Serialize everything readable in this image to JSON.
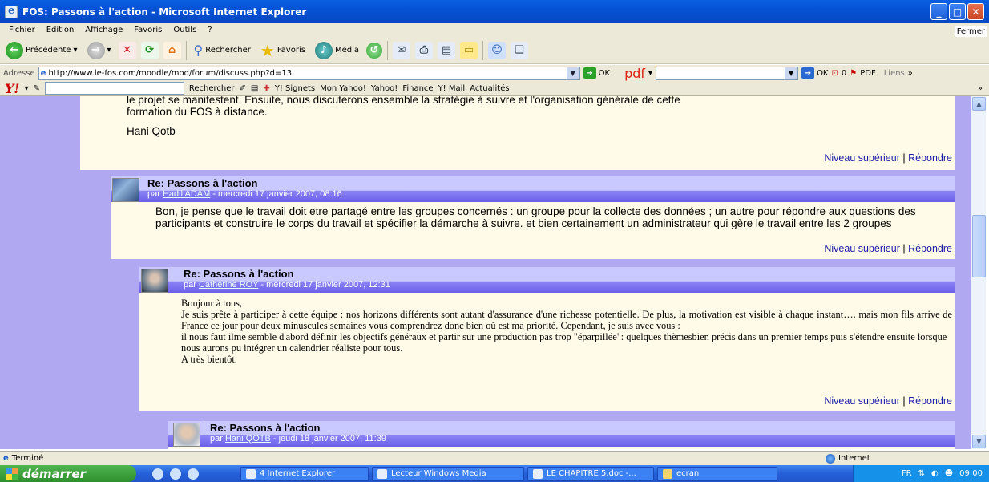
{
  "window": {
    "title": "FOS: Passons à l'action - Microsoft Internet Explorer"
  },
  "menu": {
    "items": [
      "Fichier",
      "Edition",
      "Affichage",
      "Favoris",
      "Outils",
      "?"
    ],
    "fermer": "Fermer"
  },
  "toolbar": {
    "back": "Précédente",
    "search": "Rechercher",
    "favorites": "Favoris",
    "media": "Média"
  },
  "address": {
    "label": "Adresse",
    "url": "http://www.le-fos.com/moodle/mod/forum/discuss.php?d=13",
    "go": "OK",
    "pdf": "pdf",
    "ok2": "OK",
    "count": "0",
    "pdf_btn": "PDF",
    "links": "Liens"
  },
  "yahoo": {
    "search": "Rechercher",
    "items": [
      "Y! Signets",
      "Mon Yahoo!",
      "Yahoo!",
      "Finance",
      "Y! Mail",
      "Actualités"
    ]
  },
  "posts": {
    "p0": {
      "body_lines": [
        "le projet se manifestent. Ensuite, nous discuterons ensemble la stratégie à suivre et l'organisation générale de cette",
        "formation du FOS à distance."
      ],
      "signature": "Hani Qotb",
      "link_up": "Niveau supérieur",
      "link_reply": "Répondre"
    },
    "p1": {
      "title": "Re: Passons à l'action",
      "by": "par",
      "author": "Hadil ADAM",
      "date": " - mercredi 17 janvier 2007, 08:16",
      "body": "Bon, je pense que le travail doit etre partagé entre les groupes concernés : un groupe pour la collecte des données ; un autre pour répondre aux questions des participants et construire le corps du travail et spécifier la démarche à suivre. et bien certainement un administrateur qui gère le travail entre les 2 groupes",
      "link_up": "Niveau supérieur",
      "link_reply": "Répondre"
    },
    "p2": {
      "title": "Re: Passons à l'action",
      "by": "par",
      "author": "Catherine ROY",
      "date": " - mercredi 17 janvier 2007, 12:31",
      "greeting": "Bonjour à tous,",
      "body": "Je suis prête à participer à cette équipe : nos horizons différents sont autant d'assurance d'une richesse potentielle. De plus, la motivation est visible à chaque instant…. mais mon fils arrive de France ce jour pour deux minuscules semaines vous comprendrez donc bien où est ma priorité. Cependant, je suis avec vous :",
      "body2": "il nous faut ilme semble d'abord définir les objectifs généraux et partir sur une production pas trop \"éparpillée\": quelques thèmesbien précis dans un premier temps puis s'étendre ensuite lorsque nous aurons pu  intégrer un calendrier réaliste pour tous.",
      "closing": "A très bientôt.",
      "link_up": "Niveau supérieur",
      "link_reply": "Répondre"
    },
    "p3": {
      "title": "Re: Passons à l'action",
      "by": "par",
      "author": "Hani QOTB",
      "date": " - jeudi 18 janvier 2007, 11:39"
    }
  },
  "status": {
    "text": "Terminé",
    "zone": "Internet"
  },
  "taskbar": {
    "start": "démarrer",
    "tasks": [
      "4 Internet Explorer",
      "Lecteur Windows Media",
      "LE CHAPITRE 5.doc -...",
      "ecran"
    ],
    "lang": "FR",
    "clock": "09:00"
  }
}
